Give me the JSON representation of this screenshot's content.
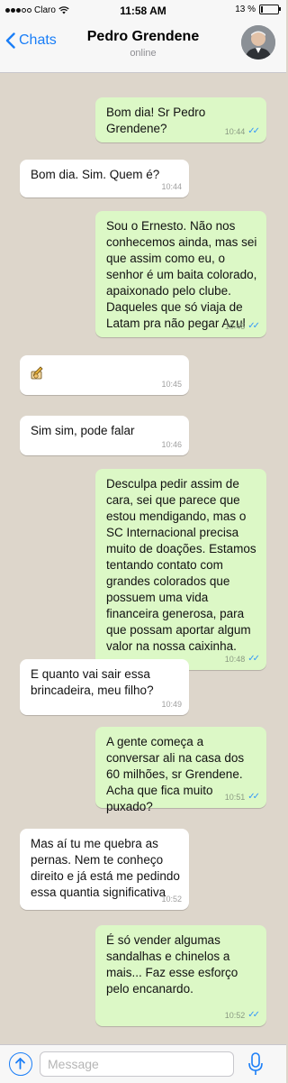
{
  "status_bar": {
    "carrier": "Claro",
    "time": "11:58 AM",
    "battery": "13 %",
    "battery_level": 0.13
  },
  "header": {
    "back_label": "Chats",
    "contact_name": "Pedro Grendene",
    "status": "online",
    "icons": {
      "back": "chevron-left-icon",
      "avatar": "contact-avatar"
    }
  },
  "messages": [
    {
      "direction": "out",
      "text": "Bom dia! Sr Pedro Grendene?",
      "time": "10:44",
      "read": true
    },
    {
      "direction": "in",
      "text": "Bom dia. Sim. Quem é?",
      "time": "10:44"
    },
    {
      "direction": "out",
      "text": "Sou o Ernesto. Não nos conhecemos ainda, mas sei que assim como eu, o senhor é um baita colorado, apaixonado pelo clube. Daqueles que só viaja de Latam pra não pegar Azul",
      "time": "10:45",
      "read": true
    },
    {
      "direction": "in",
      "text": "",
      "emoji": "writing-hand-emoji",
      "time": "10:45"
    },
    {
      "direction": "in",
      "text": "Sim sim, pode falar",
      "time": "10:46"
    },
    {
      "direction": "out",
      "text": "Desculpa pedir assim de cara, sei que parece que estou mendigando, mas o SC Internacional precisa muito de doações. Estamos tentando contato com grandes colorados que possuem uma vida financeira generosa, para que possam aportar algum valor na nossa caixinha.",
      "time": "10:48",
      "read": true
    },
    {
      "direction": "in",
      "text": "E quanto vai sair essa brincadeira, meu filho?",
      "time": "10:49"
    },
    {
      "direction": "out",
      "text": "A gente começa a conversar ali na casa dos 60 milhões, sr Grendene. Acha que fica muito puxado?",
      "time": "10:51",
      "read": true
    },
    {
      "direction": "in",
      "text": "Mas aí tu me quebra as pernas. Nem te conheço direito e já está me pedindo essa quantia significativa",
      "time": "10:52"
    },
    {
      "direction": "out",
      "text": "É só vender algumas sandalhas e chinelos a mais... Faz esse esforço pelo encanardo.",
      "time": "10:52",
      "read": true
    }
  ],
  "input_bar": {
    "placeholder": "Message",
    "icons": {
      "left": "upload-arrow-icon",
      "right": "microphone-icon"
    }
  },
  "colors": {
    "outgoing_bubble": "#dcf8c6",
    "incoming_bubble": "#ffffff",
    "accent": "#1a7ef7",
    "read_ticks": "#3497f9",
    "chat_background": "#ddd6cb"
  }
}
